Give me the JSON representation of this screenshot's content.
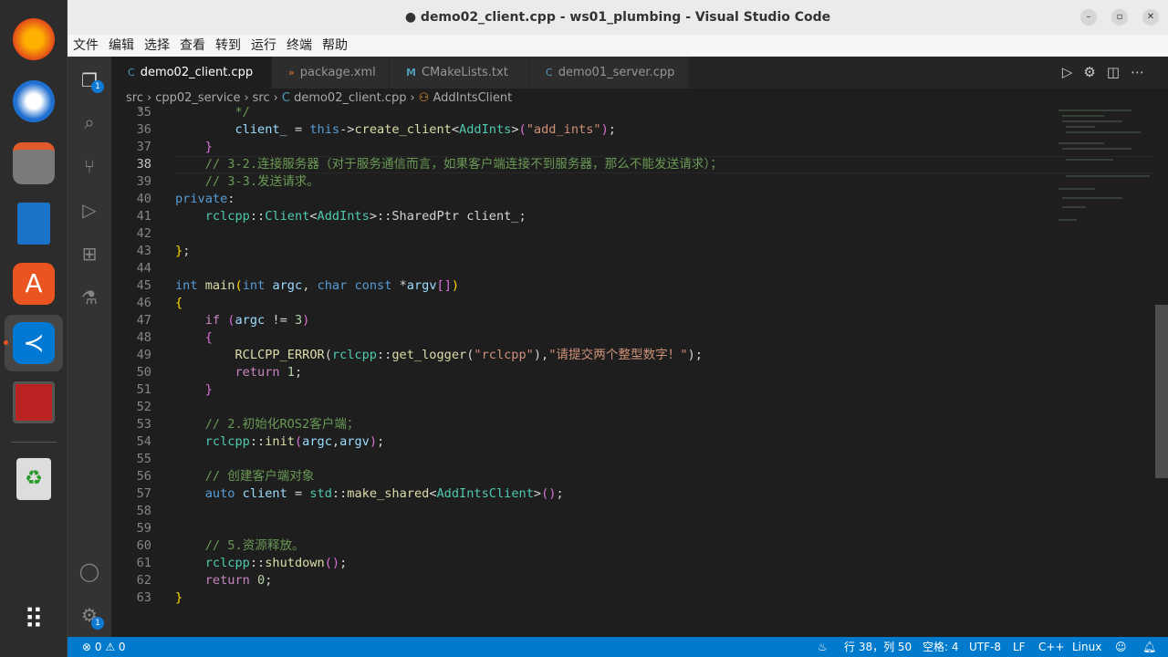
{
  "window": {
    "title": "● demo02_client.cpp - ws01_plumbing - Visual Studio Code"
  },
  "menu": [
    "文件",
    "编辑",
    "选择",
    "查看",
    "转到",
    "运行",
    "终端",
    "帮助"
  ],
  "activity": {
    "explorer_badge": "1",
    "settings_badge": "1"
  },
  "tabs": [
    {
      "label": "demo02_client.cpp",
      "icon": "C",
      "modified": "●"
    },
    {
      "label": "package.xml",
      "icon": "»"
    },
    {
      "label": "CMakeLists.txt",
      "icon": "M"
    },
    {
      "label": "demo01_server.cpp",
      "icon": "C"
    }
  ],
  "breadcrumb": [
    "src",
    "cpp02_service",
    "src",
    "demo02_client.cpp",
    "AddIntsClient"
  ],
  "editor": {
    "current_line": 38,
    "lines": [
      {
        "n": 35,
        "t": [
          [
            "c",
            "        */"
          ]
        ]
      },
      {
        "n": 36,
        "t": [
          [
            "v",
            "        client_"
          ],
          [
            "p",
            " = "
          ],
          [
            "k",
            "this"
          ],
          [
            "p",
            "->"
          ],
          [
            "f",
            "create_client"
          ],
          [
            "p",
            "<"
          ],
          [
            "t",
            "AddInts"
          ],
          [
            "p",
            ">"
          ],
          [
            "b",
            "("
          ],
          [
            "s",
            "\"add_ints\""
          ],
          [
            "b",
            ")"
          ],
          [
            "p",
            ";"
          ]
        ]
      },
      {
        "n": 37,
        "t": [
          [
            "b",
            "    }"
          ]
        ]
      },
      {
        "n": 38,
        "t": [
          [
            "c",
            "    // 3-2.连接服务器（对于服务通信而言，如果客户端连接不到服务器，那么不能发送请求）；"
          ]
        ]
      },
      {
        "n": 39,
        "t": [
          [
            "c",
            "    // 3-3.发送请求。"
          ]
        ]
      },
      {
        "n": 40,
        "t": [
          [
            "k",
            "private"
          ],
          [
            "p",
            ":"
          ]
        ]
      },
      {
        "n": 41,
        "t": [
          [
            "t",
            "    rclcpp"
          ],
          [
            "p",
            "::"
          ],
          [
            "t",
            "Client"
          ],
          [
            "p",
            "<"
          ],
          [
            "t",
            "AddInts"
          ],
          [
            "p",
            ">::SharedPtr client_;"
          ]
        ]
      },
      {
        "n": 42,
        "t": []
      },
      {
        "n": 43,
        "t": [
          [
            "y",
            "}"
          ],
          [
            "p",
            ";"
          ]
        ]
      },
      {
        "n": 44,
        "t": []
      },
      {
        "n": 45,
        "t": [
          [
            "k",
            "int"
          ],
          [
            "p",
            " "
          ],
          [
            "f",
            "main"
          ],
          [
            "y",
            "("
          ],
          [
            "k",
            "int"
          ],
          [
            "p",
            " "
          ],
          [
            "v",
            "argc"
          ],
          [
            "p",
            ", "
          ],
          [
            "k",
            "char"
          ],
          [
            "p",
            " "
          ],
          [
            "k",
            "const"
          ],
          [
            "p",
            " *"
          ],
          [
            "v",
            "argv"
          ],
          [
            "b",
            "[]"
          ],
          [
            "y",
            ")"
          ]
        ]
      },
      {
        "n": 46,
        "t": [
          [
            "y",
            "{"
          ]
        ]
      },
      {
        "n": 47,
        "t": [
          [
            "q",
            "    if"
          ],
          [
            "p",
            " "
          ],
          [
            "b",
            "("
          ],
          [
            "v",
            "argc"
          ],
          [
            "p",
            " != "
          ],
          [
            "n",
            "3"
          ],
          [
            "b",
            ")"
          ]
        ]
      },
      {
        "n": 48,
        "t": [
          [
            "b",
            "    {"
          ]
        ]
      },
      {
        "n": 49,
        "t": [
          [
            "f",
            "        RCLCPP_ERROR"
          ],
          [
            "p",
            "("
          ],
          [
            "t",
            "rclcpp"
          ],
          [
            "p",
            "::"
          ],
          [
            "f",
            "get_logger"
          ],
          [
            "p",
            "("
          ],
          [
            "s",
            "\"rclcpp\""
          ],
          [
            "p",
            "),"
          ],
          [
            "s",
            "\"请提交两个整型数字！\""
          ],
          [
            "p",
            ");"
          ]
        ]
      },
      {
        "n": 50,
        "t": [
          [
            "q",
            "        return"
          ],
          [
            "p",
            " "
          ],
          [
            "n",
            "1"
          ],
          [
            "p",
            ";"
          ]
        ]
      },
      {
        "n": 51,
        "t": [
          [
            "b",
            "    }"
          ]
        ]
      },
      {
        "n": 52,
        "t": []
      },
      {
        "n": 53,
        "t": [
          [
            "c",
            "    // 2.初始化ROS2客户端；"
          ]
        ]
      },
      {
        "n": 54,
        "t": [
          [
            "t",
            "    rclcpp"
          ],
          [
            "p",
            "::"
          ],
          [
            "f",
            "init"
          ],
          [
            "b",
            "("
          ],
          [
            "v",
            "argc"
          ],
          [
            "p",
            ","
          ],
          [
            "v",
            "argv"
          ],
          [
            "b",
            ")"
          ],
          [
            "p",
            ";"
          ]
        ]
      },
      {
        "n": 55,
        "t": []
      },
      {
        "n": 56,
        "t": [
          [
            "c",
            "    // 创建客户端对象"
          ]
        ]
      },
      {
        "n": 57,
        "t": [
          [
            "k",
            "    auto"
          ],
          [
            "p",
            " "
          ],
          [
            "v",
            "client"
          ],
          [
            "p",
            " = "
          ],
          [
            "t",
            "std"
          ],
          [
            "p",
            "::"
          ],
          [
            "f",
            "make_shared"
          ],
          [
            "p",
            "<"
          ],
          [
            "t",
            "AddIntsClient"
          ],
          [
            "p",
            ">"
          ],
          [
            "b",
            "()"
          ],
          [
            "p",
            ";"
          ]
        ]
      },
      {
        "n": 58,
        "t": []
      },
      {
        "n": 59,
        "t": []
      },
      {
        "n": 60,
        "t": [
          [
            "c",
            "    // 5.资源释放。"
          ]
        ]
      },
      {
        "n": 61,
        "t": [
          [
            "t",
            "    rclcpp"
          ],
          [
            "p",
            "::"
          ],
          [
            "f",
            "shutdown"
          ],
          [
            "b",
            "()"
          ],
          [
            "p",
            ";"
          ]
        ]
      },
      {
        "n": 62,
        "t": [
          [
            "q",
            "    return"
          ],
          [
            "p",
            " "
          ],
          [
            "n",
            "0"
          ],
          [
            "p",
            ";"
          ]
        ]
      },
      {
        "n": 63,
        "t": [
          [
            "y",
            "}"
          ]
        ]
      }
    ]
  },
  "status": {
    "errors": "0",
    "warnings": "0",
    "position": "行 38，列 50",
    "indent": "空格: 4",
    "encoding": "UTF-8",
    "eol": "LF",
    "language": "C++",
    "os": "Linux"
  }
}
